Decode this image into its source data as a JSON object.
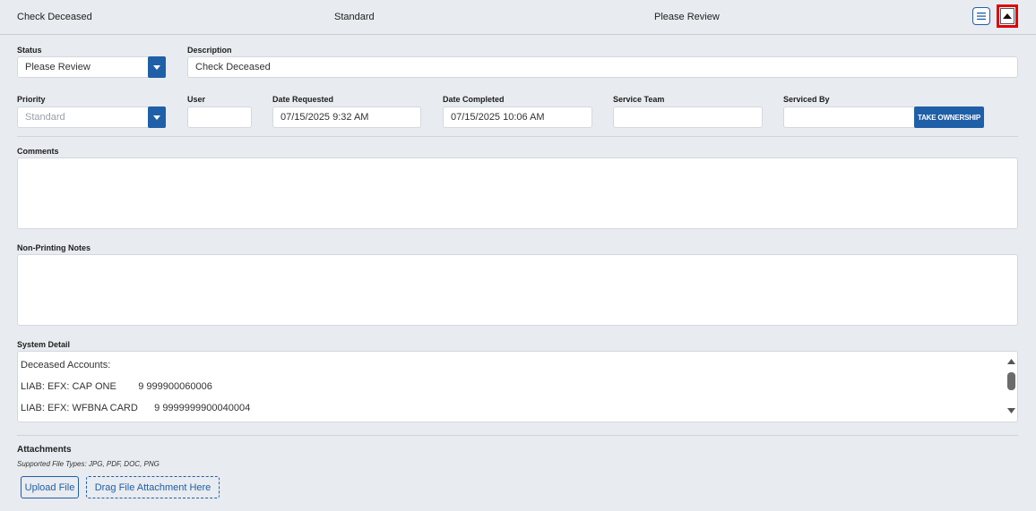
{
  "header": {
    "description": "Check Deceased",
    "priority": "Standard",
    "status": "Please Review"
  },
  "form": {
    "status_label": "Status",
    "status_value": "Please Review",
    "description_label": "Description",
    "description_value": "Check Deceased",
    "priority_label": "Priority",
    "priority_value": "Standard",
    "user_label": "User",
    "user_value": "",
    "date_requested_label": "Date Requested",
    "date_requested_value": "07/15/2025 9:32 AM",
    "date_completed_label": "Date Completed",
    "date_completed_value": "07/15/2025 10:06 AM",
    "service_team_label": "Service Team",
    "service_team_value": "",
    "serviced_by_label": "Serviced By",
    "serviced_by_value": "",
    "take_ownership_label": "TAKE OWNERSHIP",
    "comments_label": "Comments",
    "notes_label": "Non-Printing Notes",
    "system_detail_label": "System Detail",
    "system_detail_lines": [
      "Deceased Accounts:",
      "LIAB: EFX: CAP ONE        9 999900060006",
      "LIAB: EFX: WFBNA CARD      9 9999999900040004"
    ]
  },
  "attachments": {
    "title": "Attachments",
    "supported": "Supported File Types: JPG, PDF, DOC, PNG",
    "upload_label": "Upload File",
    "drag_label": "Drag File Attachment Here"
  },
  "colors": {
    "accent": "#1f5fa8",
    "highlight": "#e00000",
    "background": "#e8ebef"
  }
}
